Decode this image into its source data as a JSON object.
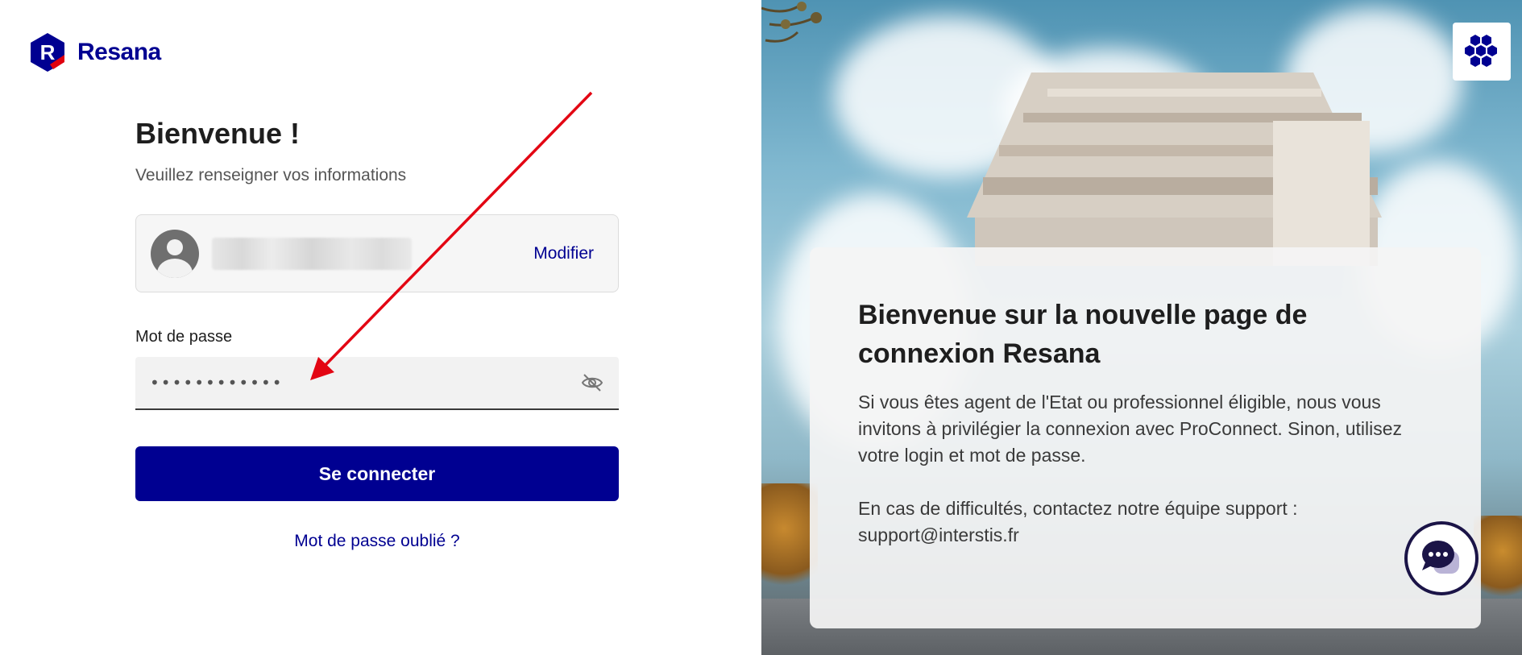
{
  "brand": {
    "name": "Resana",
    "color": "#000091"
  },
  "login": {
    "title": "Bienvenue !",
    "subtitle": "Veuillez renseigner vos informations",
    "modify_label": "Modifier",
    "password_label": "Mot de passe",
    "password_value": "••••••••••••",
    "connect_label": "Se connecter",
    "forgot_label": "Mot de passe oublié ?"
  },
  "info": {
    "title": "Bienvenue sur la nouvelle page de connexion Resana",
    "paragraph1": "Si vous êtes agent de l'Etat ou professionnel éligible, nous vous invitons à privilégier la connexion avec ProConnect. Sinon, utilisez votre login et mot de passe.",
    "paragraph2": "En cas de difficultés, contactez notre équipe support : support@interstis.fr"
  },
  "icons": {
    "avatar": "user-avatar-icon",
    "password_toggle": "eye-off-icon",
    "apps": "hexagon-grid-icon",
    "chat": "chat-bubble-icon"
  },
  "colors": {
    "primary": "#000091",
    "annotation_arrow": "#e30613",
    "chat_border": "#1b1447"
  }
}
